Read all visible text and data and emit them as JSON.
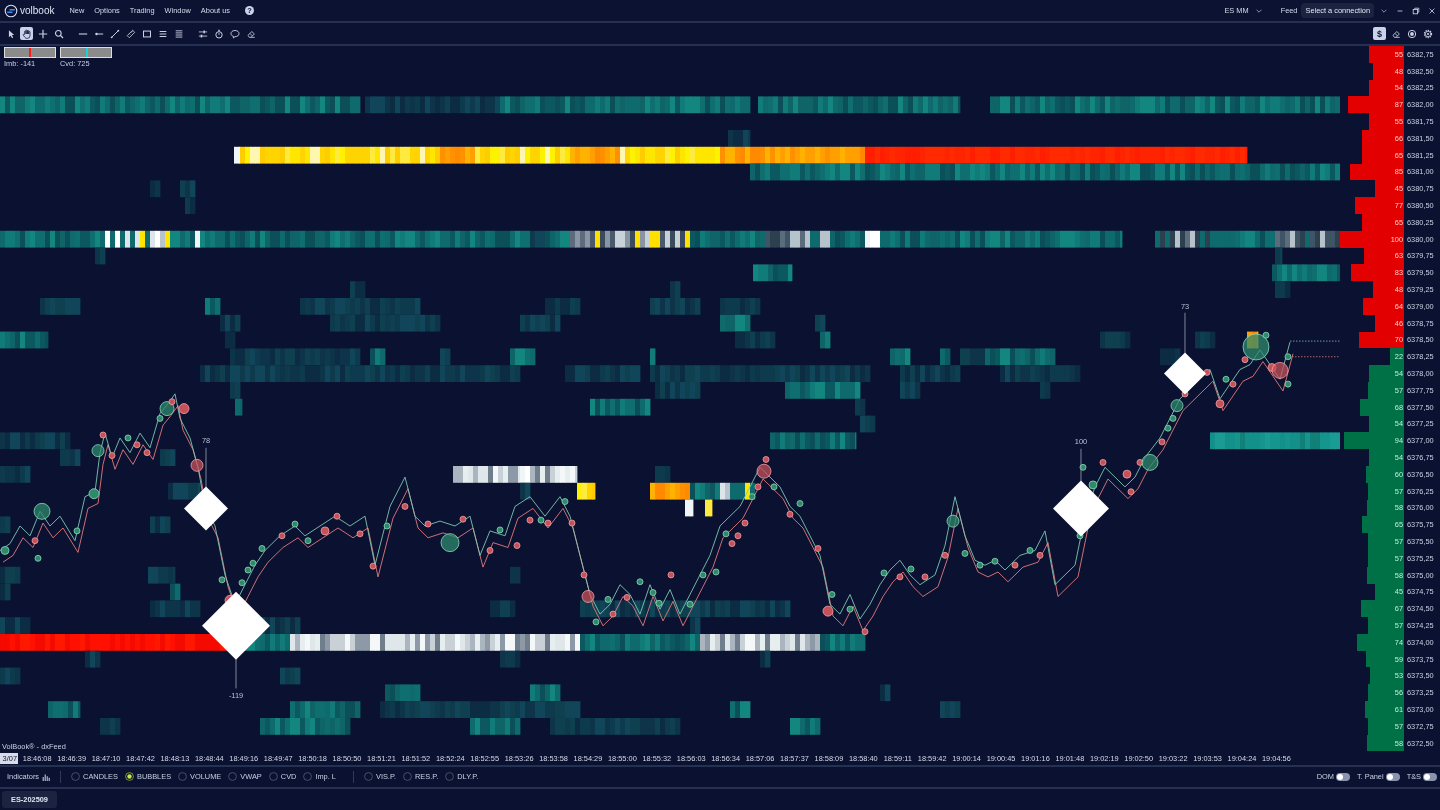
{
  "title_bar": {
    "logo": "volbook",
    "menu": [
      "New",
      "Options",
      "Trading",
      "Window",
      "About us"
    ],
    "help": "?",
    "workspace": "ES MM",
    "feed_label": "Feed",
    "connection_button": "Select a connection"
  },
  "toolbar": {
    "tool_groups": [
      [
        {
          "kind": "pointer",
          "selected": false
        },
        {
          "kind": "hand",
          "selected": true
        },
        {
          "kind": "crosshair",
          "selected": false
        },
        {
          "kind": "zoom",
          "selected": false
        }
      ],
      [
        {
          "kind": "horizontal_line",
          "selected": false
        },
        {
          "kind": "ray",
          "selected": false
        },
        {
          "kind": "trend_line",
          "selected": false
        },
        {
          "kind": "ruler",
          "selected": false
        },
        {
          "kind": "rectangle",
          "selected": false
        },
        {
          "kind": "lines",
          "selected": false
        },
        {
          "kind": "dense_lines",
          "selected": false
        }
      ],
      [
        {
          "kind": "sliders",
          "selected": false
        },
        {
          "kind": "stopwatch",
          "selected": false
        },
        {
          "kind": "comment",
          "selected": false
        },
        {
          "kind": "eraser",
          "selected": false
        }
      ]
    ],
    "right_tools": [
      {
        "kind": "dollar",
        "label": "$",
        "selected": true
      },
      {
        "kind": "eraser",
        "selected": false
      },
      {
        "kind": "target",
        "selected": false
      },
      {
        "kind": "settings",
        "selected": false
      }
    ]
  },
  "chart": {
    "gauges": [
      {
        "label": "Imb: -141",
        "level": 0.48,
        "color": "#ff1a1a"
      },
      {
        "label": "Cvd: 725",
        "level": 0.5,
        "color": "#19d3d3"
      }
    ],
    "delta_markers": [
      {
        "label": "78"
      },
      {
        "label": "-119"
      },
      {
        "label": "100"
      },
      {
        "label": "73"
      }
    ],
    "source_label": "VolBook® - dxFeed",
    "ladder": [
      {
        "volume": "55",
        "price": "6382,75",
        "kind": "ask",
        "level": 0.55
      },
      {
        "volume": "48",
        "price": "6382,50",
        "kind": "ask",
        "level": 0.48
      },
      {
        "volume": "54",
        "price": "6382,25",
        "kind": "ask",
        "level": 0.54
      },
      {
        "volume": "87",
        "price": "6382,00",
        "kind": "ask",
        "level": 0.87
      },
      {
        "volume": "55",
        "price": "6381,75",
        "kind": "ask",
        "level": 0.55
      },
      {
        "volume": "66",
        "price": "6381,50",
        "kind": "ask",
        "level": 0.66
      },
      {
        "volume": "65",
        "price": "6381,25",
        "kind": "ask",
        "level": 0.65
      },
      {
        "volume": "85",
        "price": "6381,00",
        "kind": "ask",
        "level": 0.85
      },
      {
        "volume": "45",
        "price": "6380,75",
        "kind": "ask",
        "level": 0.45
      },
      {
        "volume": "77",
        "price": "6380,50",
        "kind": "ask",
        "level": 0.77
      },
      {
        "volume": "65",
        "price": "6380,25",
        "kind": "ask",
        "level": 0.65
      },
      {
        "volume": "100",
        "price": "6380,00",
        "kind": "ask",
        "level": 1.0
      },
      {
        "volume": "63",
        "price": "6379,75",
        "kind": "ask",
        "level": 0.63
      },
      {
        "volume": "83",
        "price": "6379,50",
        "kind": "ask",
        "level": 0.83
      },
      {
        "volume": "48",
        "price": "6379,25",
        "kind": "ask",
        "level": 0.48
      },
      {
        "volume": "64",
        "price": "6379,00",
        "kind": "ask",
        "level": 0.64
      },
      {
        "volume": "46",
        "price": "6378,75",
        "kind": "ask",
        "level": 0.46
      },
      {
        "volume": "70",
        "price": "6378,50",
        "kind": "ask",
        "level": 0.7
      },
      {
        "volume": "22",
        "price": "6378,25",
        "kind": "bid",
        "level": 0.22
      },
      {
        "volume": "54",
        "price": "6378,00",
        "kind": "bid",
        "level": 0.54
      },
      {
        "volume": "57",
        "price": "6377,75",
        "kind": "bid",
        "level": 0.57
      },
      {
        "volume": "68",
        "price": "6377,50",
        "kind": "bid",
        "level": 0.68
      },
      {
        "volume": "54",
        "price": "6377,25",
        "kind": "bid",
        "level": 0.54
      },
      {
        "volume": "94",
        "price": "6377,00",
        "kind": "bid",
        "level": 0.94
      },
      {
        "volume": "54",
        "price": "6376,75",
        "kind": "bid",
        "level": 0.54
      },
      {
        "volume": "60",
        "price": "6376,50",
        "kind": "bid",
        "level": 0.6
      },
      {
        "volume": "57",
        "price": "6376,25",
        "kind": "bid",
        "level": 0.57
      },
      {
        "volume": "58",
        "price": "6376,00",
        "kind": "bid",
        "level": 0.58
      },
      {
        "volume": "65",
        "price": "6375,75",
        "kind": "bid",
        "level": 0.65
      },
      {
        "volume": "57",
        "price": "6375,50",
        "kind": "bid",
        "level": 0.57
      },
      {
        "volume": "57",
        "price": "6375,25",
        "kind": "bid",
        "level": 0.57
      },
      {
        "volume": "58",
        "price": "6375,00",
        "kind": "bid",
        "level": 0.58
      },
      {
        "volume": "45",
        "price": "6374,75",
        "kind": "bid",
        "level": 0.45
      },
      {
        "volume": "67",
        "price": "6374,50",
        "kind": "bid",
        "level": 0.67
      },
      {
        "volume": "57",
        "price": "6374,25",
        "kind": "bid",
        "level": 0.57
      },
      {
        "volume": "74",
        "price": "6374,00",
        "kind": "bid",
        "level": 0.74
      },
      {
        "volume": "59",
        "price": "6373,75",
        "kind": "bid",
        "level": 0.59
      },
      {
        "volume": "53",
        "price": "6373,50",
        "kind": "bid",
        "level": 0.53
      },
      {
        "volume": "56",
        "price": "6373,25",
        "kind": "bid",
        "level": 0.56
      },
      {
        "volume": "61",
        "price": "6373,00",
        "kind": "bid",
        "level": 0.61
      },
      {
        "volume": "57",
        "price": "6372,75",
        "kind": "bid",
        "level": 0.57
      },
      {
        "volume": "58",
        "price": "6372,50",
        "kind": "bid",
        "level": 0.58
      }
    ],
    "time_axis": {
      "date": "3/07",
      "times": [
        "18:46:08",
        "18:46:39",
        "18:47:10",
        "18:47:42",
        "18:48:13",
        "18:48:44",
        "18:49:16",
        "18:49:47",
        "18:50:18",
        "18:50:50",
        "18:51:21",
        "18:51:52",
        "18:52:24",
        "18:52:55",
        "18:53:26",
        "18:53:58",
        "18:54:29",
        "18:55:00",
        "18:55:32",
        "18:56:03",
        "18:56:34",
        "18:57:06",
        "18:57:37",
        "18:58:09",
        "18:58:40",
        "18:59:11",
        "18:59:42",
        "19:00:14",
        "19:00:45",
        "19:01:16",
        "19:01:48",
        "19:02:19",
        "19:02:50",
        "19:03:22",
        "19:03:53",
        "19:04:24",
        "19:04:56"
      ]
    }
  },
  "indicator_bar": {
    "label": "Indicators",
    "options": [
      {
        "label": "CANDLES",
        "selected": false
      },
      {
        "label": "BUBBLES",
        "selected": true
      },
      {
        "label": "VOLUME",
        "selected": false
      },
      {
        "label": "VWAP",
        "selected": false
      },
      {
        "label": "CVD",
        "selected": false
      },
      {
        "label": "Imp. L",
        "selected": false
      }
    ],
    "profile_options": [
      {
        "label": "VIS.P.",
        "selected": false
      },
      {
        "label": "RES.P.",
        "selected": false
      },
      {
        "label": "DLY.P.",
        "selected": false
      }
    ],
    "toggles": [
      {
        "label": "DOM",
        "on": false
      },
      {
        "label": "T. Panel",
        "on": false
      },
      {
        "label": "T&S",
        "on": false
      }
    ]
  },
  "tabs": [
    {
      "label": "ES-202509",
      "selected": true
    }
  ]
}
